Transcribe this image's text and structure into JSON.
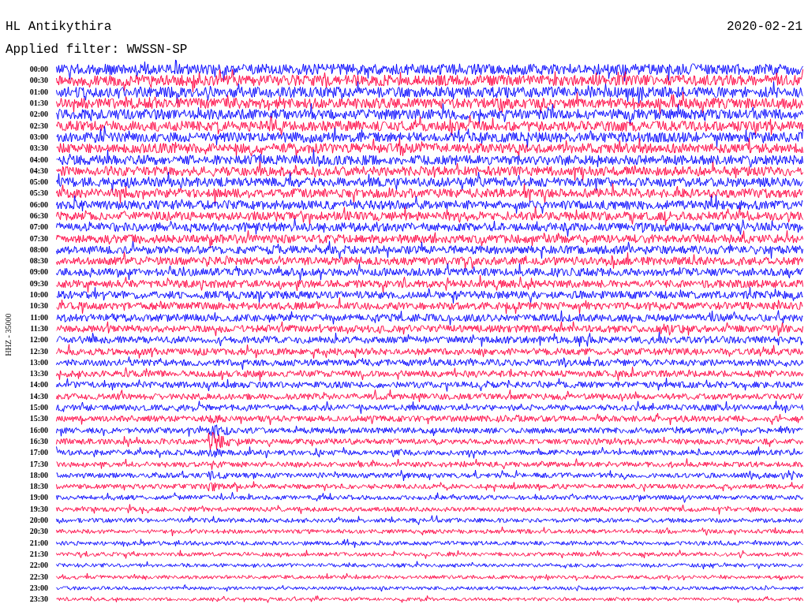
{
  "header": {
    "station": "HL Antikythira",
    "date": "2020-02-21",
    "filter": "Applied filter: WWSSN-SP"
  },
  "axis_label": "HHZ - 35000",
  "rows": [
    {
      "label": "00:00",
      "color": "#0000ff"
    },
    {
      "label": "00:30",
      "color": "#ff0040"
    },
    {
      "label": "01:00",
      "color": "#0000ff"
    },
    {
      "label": "01:30",
      "color": "#ff0040"
    },
    {
      "label": "02:00",
      "color": "#0000ff"
    },
    {
      "label": "02:30",
      "color": "#ff0040"
    },
    {
      "label": "03:00",
      "color": "#0000ff"
    },
    {
      "label": "03:30",
      "color": "#ff0040"
    },
    {
      "label": "04:00",
      "color": "#0000ff"
    },
    {
      "label": "04:30",
      "color": "#ff0040"
    },
    {
      "label": "05:00",
      "color": "#0000ff"
    },
    {
      "label": "05:30",
      "color": "#ff0040"
    },
    {
      "label": "06:00",
      "color": "#0000ff"
    },
    {
      "label": "06:30",
      "color": "#ff0040"
    },
    {
      "label": "07:00",
      "color": "#0000ff"
    },
    {
      "label": "07:30",
      "color": "#ff0040"
    },
    {
      "label": "08:00",
      "color": "#0000ff"
    },
    {
      "label": "08:30",
      "color": "#ff0040"
    },
    {
      "label": "09:00",
      "color": "#0000ff"
    },
    {
      "label": "09:30",
      "color": "#ff0040"
    },
    {
      "label": "10:00",
      "color": "#0000ff"
    },
    {
      "label": "10:30",
      "color": "#ff0040"
    },
    {
      "label": "11:00",
      "color": "#0000ff"
    },
    {
      "label": "11:30",
      "color": "#ff0040"
    },
    {
      "label": "12:00",
      "color": "#0000ff"
    },
    {
      "label": "12:30",
      "color": "#ff0040"
    },
    {
      "label": "13:00",
      "color": "#0000ff"
    },
    {
      "label": "13:30",
      "color": "#ff0040"
    },
    {
      "label": "14:00",
      "color": "#0000ff"
    },
    {
      "label": "14:30",
      "color": "#ff0040"
    },
    {
      "label": "15:00",
      "color": "#0000ff"
    },
    {
      "label": "15:30",
      "color": "#ff0040"
    },
    {
      "label": "16:00",
      "color": "#0000ff"
    },
    {
      "label": "16:30",
      "color": "#ff0040"
    },
    {
      "label": "17:00",
      "color": "#0000ff"
    },
    {
      "label": "17:30",
      "color": "#ff0040"
    },
    {
      "label": "18:00",
      "color": "#0000ff"
    },
    {
      "label": "18:30",
      "color": "#ff0040"
    },
    {
      "label": "19:00",
      "color": "#0000ff"
    },
    {
      "label": "19:30",
      "color": "#ff0040"
    },
    {
      "label": "20:00",
      "color": "#0000ff"
    },
    {
      "label": "20:30",
      "color": "#ff0040"
    },
    {
      "label": "21:00",
      "color": "#0000ff"
    },
    {
      "label": "21:30",
      "color": "#ff0040"
    },
    {
      "label": "22:00",
      "color": "#0000ff"
    },
    {
      "label": "22:30",
      "color": "#ff0040"
    },
    {
      "label": "23:00",
      "color": "#0000ff"
    },
    {
      "label": "23:30",
      "color": "#ff0040"
    }
  ]
}
